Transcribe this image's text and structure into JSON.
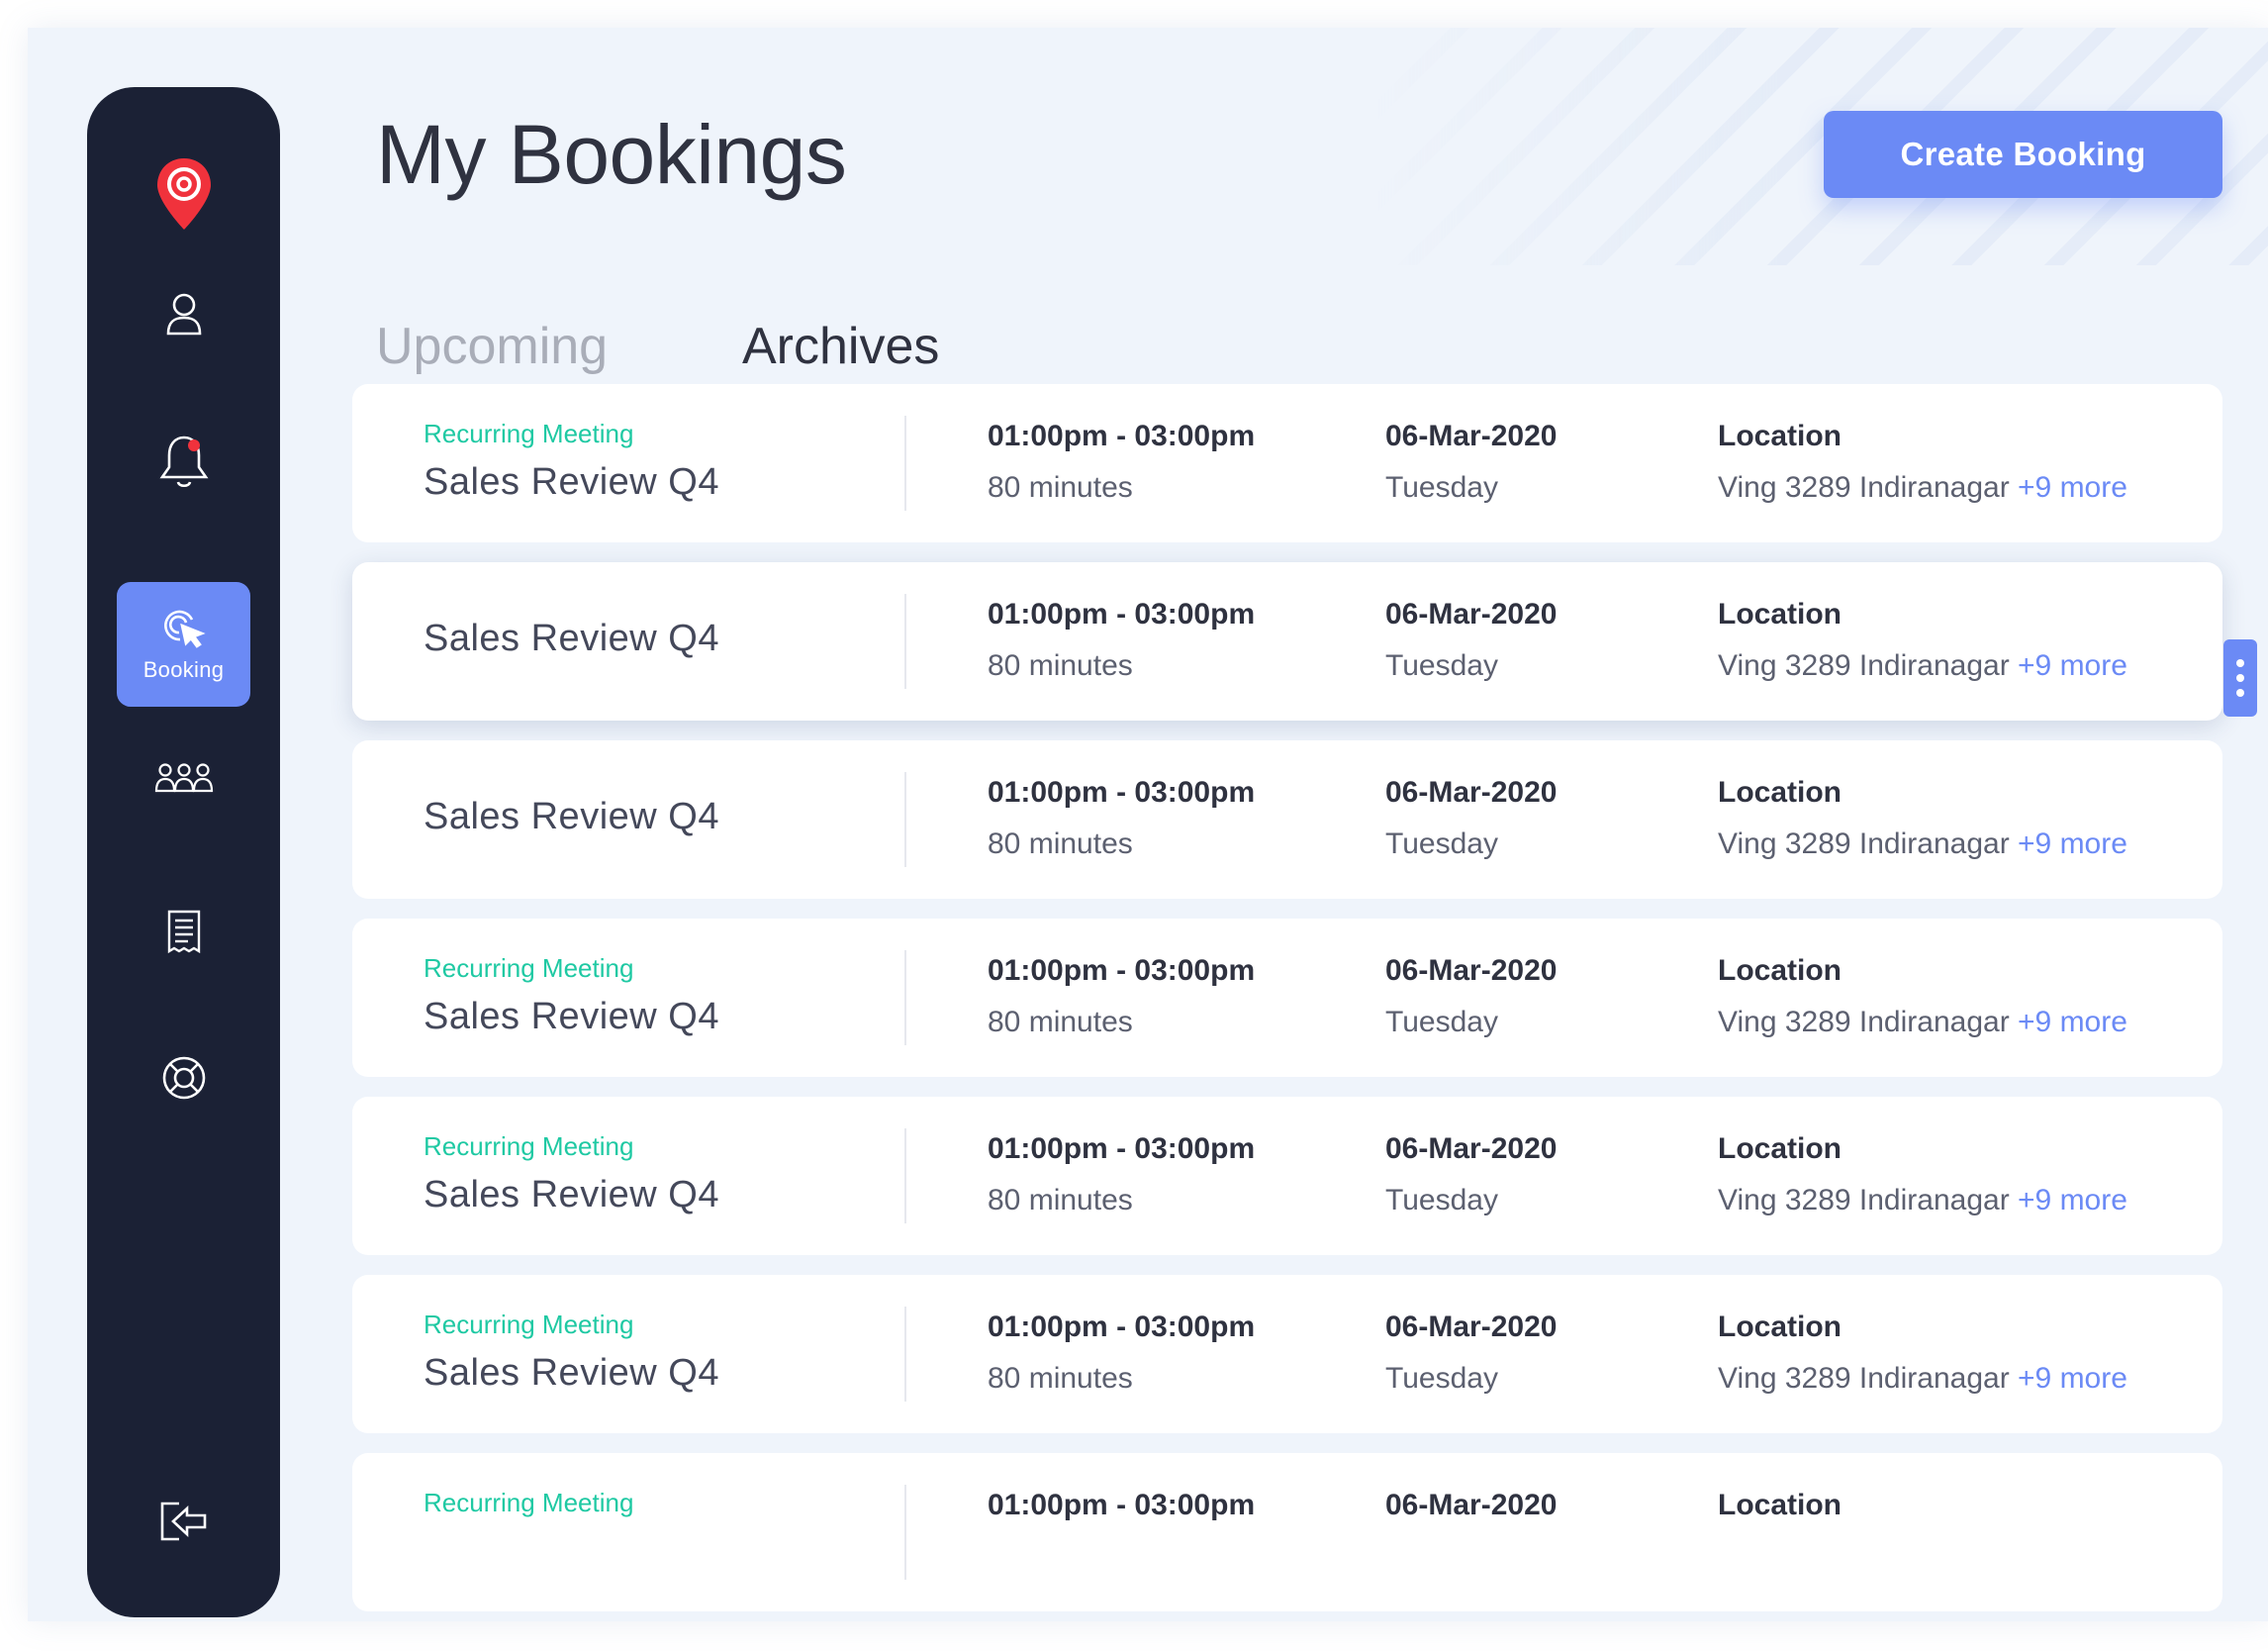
{
  "sidebar": {
    "items": [
      {
        "name": "profile",
        "icon": "user-icon"
      },
      {
        "name": "notifications",
        "icon": "bell-icon",
        "has_badge": true
      },
      {
        "name": "booking",
        "icon": "cursor-click-icon",
        "label": "Booking",
        "active": true
      },
      {
        "name": "people",
        "icon": "group-icon"
      },
      {
        "name": "receipts",
        "icon": "receipt-icon"
      },
      {
        "name": "support",
        "icon": "lifebuoy-icon"
      },
      {
        "name": "logout",
        "icon": "logout-icon"
      }
    ],
    "logo_icon": "location-pin-logo-icon"
  },
  "header": {
    "title": "My Bookings",
    "create_button": "Create Booking"
  },
  "tabs": [
    {
      "label": "Upcoming",
      "active": false
    },
    {
      "label": "Archives",
      "active": true
    }
  ],
  "bookings": [
    {
      "tag": "Recurring Meeting",
      "name": "Sales Review Q4",
      "time": "01:00pm - 03:00pm",
      "duration": "80 minutes",
      "date": "06-Mar-2020",
      "day": "Tuesday",
      "location_label": "Location",
      "location": "Ving 3289 Indiranagar",
      "more": "+9 more"
    },
    {
      "tag": "",
      "name": "Sales Review Q4",
      "time": "01:00pm - 03:00pm",
      "duration": "80 minutes",
      "date": "06-Mar-2020",
      "day": "Tuesday",
      "location_label": "Location",
      "location": "Ving 3289 Indiranagar",
      "more": "+9 more"
    },
    {
      "tag": "",
      "name": "Sales Review Q4",
      "time": "01:00pm - 03:00pm",
      "duration": "80 minutes",
      "date": "06-Mar-2020",
      "day": "Tuesday",
      "location_label": "Location",
      "location": "Ving 3289 Indiranagar",
      "more": "+9 more"
    },
    {
      "tag": "Recurring Meeting",
      "name": "Sales Review Q4",
      "time": "01:00pm - 03:00pm",
      "duration": "80 minutes",
      "date": "06-Mar-2020",
      "day": "Tuesday",
      "location_label": "Location",
      "location": "Ving 3289 Indiranagar",
      "more": "+9 more"
    },
    {
      "tag": "Recurring Meeting",
      "name": "Sales Review Q4",
      "time": "01:00pm - 03:00pm",
      "duration": "80 minutes",
      "date": "06-Mar-2020",
      "day": "Tuesday",
      "location_label": "Location",
      "location": "Ving 3289 Indiranagar",
      "more": "+9 more"
    },
    {
      "tag": "Recurring Meeting",
      "name": "Sales Review Q4",
      "time": "01:00pm - 03:00pm",
      "duration": "80 minutes",
      "date": "06-Mar-2020",
      "day": "Tuesday",
      "location_label": "Location",
      "location": "Ving 3289 Indiranagar",
      "more": "+9 more"
    },
    {
      "tag": "Recurring Meeting",
      "name": "",
      "time": "01:00pm - 03:00pm",
      "duration": "",
      "date": "06-Mar-2020",
      "day": "",
      "location_label": "Location",
      "location": "",
      "more": ""
    }
  ],
  "row_menu_icon": "more-vertical-icon",
  "colors": {
    "sidebar_bg": "#1b2135",
    "accent": "#6b8af5",
    "recurring_tag": "#1fc9a3",
    "page_bg": "#eff4fb",
    "logo_red": "#f0323c"
  }
}
